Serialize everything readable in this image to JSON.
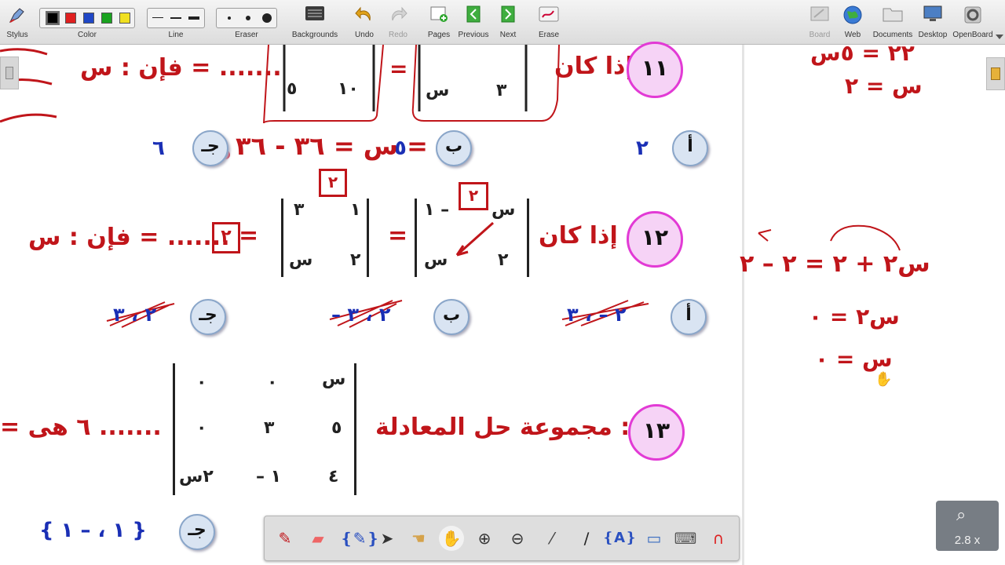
{
  "toolbar": {
    "stylus": "Stylus",
    "color": "Color",
    "line": "Line",
    "eraser": "Eraser",
    "backgrounds": "Backgrounds",
    "undo": "Undo",
    "redo": "Redo",
    "pages": "Pages",
    "previous": "Previous",
    "next": "Next",
    "erase": "Erase",
    "board": "Board",
    "web": "Web",
    "documents": "Documents",
    "desktop": "Desktop",
    "openboard": "OpenBoard"
  },
  "colors": {
    "swatches": [
      "#000000",
      "#e02020",
      "#1f47c6",
      "#1aa320",
      "#f0e020"
    ],
    "ink_red": "#c0151a",
    "ink_blue": "#1a2fb5",
    "question_circle": "#f6d3f6",
    "question_border": "#e23ad5",
    "option_circle": "#d9e4f2"
  },
  "q11": {
    "number": "١١",
    "prefix": "إذا كان :",
    "left_matrix": {
      "r2c1": "٣",
      "r2c2": "س"
    },
    "equals": "=",
    "right_matrix": {
      "r2c1": "١٠",
      "r2c2": "٥"
    },
    "suffix": "فإن : س = .......",
    "opt_a": "أ",
    "opt_a_value": "٢",
    "opt_b": "ب",
    "opt_b_value": "٥",
    "opt_c": "جـ",
    "opt_c_value": "٦",
    "work": "س = ٣٦ - ٣٦ ="
  },
  "q12": {
    "number": "١٢",
    "prefix": "إذا كان :",
    "left_matrix": {
      "r1c1": "س",
      "r1c2": "١ –",
      "r2c1": "٢",
      "r2c2": "س"
    },
    "equals": "=",
    "right_matrix": {
      "r1c1": "١",
      "r1c2": "٣",
      "r2c1": "٢",
      "r2c2": "س"
    },
    "boxed_left": "٢",
    "boxed_right": "٢",
    "boxed_mid": "٢",
    "suffix": "فإن : س = .......",
    "opt_a": "أ",
    "opt_a_value": "٢ – ، ٣",
    "opt_b": "ب",
    "opt_b_value": "– ٢ ، ٣",
    "opt_c": "جـ",
    "opt_c_value": "٢ ، ٣"
  },
  "q13": {
    "number": "١٣",
    "prefix": "مجموعة حل المعادلة :",
    "matrix": {
      "r1": [
        "س",
        "٠",
        "٠"
      ],
      "r2": [
        "٥",
        "٣",
        "٠"
      ],
      "r3": [
        "٤",
        "– ١",
        "٢س"
      ]
    },
    "suffix": "= ٦ هى .......",
    "opt_c": "جـ",
    "opt_c_value": "{ ١ ، – ١ }"
  },
  "side_work": {
    "line1": "٢٢ = ٥س",
    "line2": "س = ٢",
    "line3": "س٢ + ٢ = ٢ – ٢",
    "line4": "س٢ = ٠",
    "line5": "س = ٠"
  },
  "zoom": {
    "value": "2.8 x"
  }
}
